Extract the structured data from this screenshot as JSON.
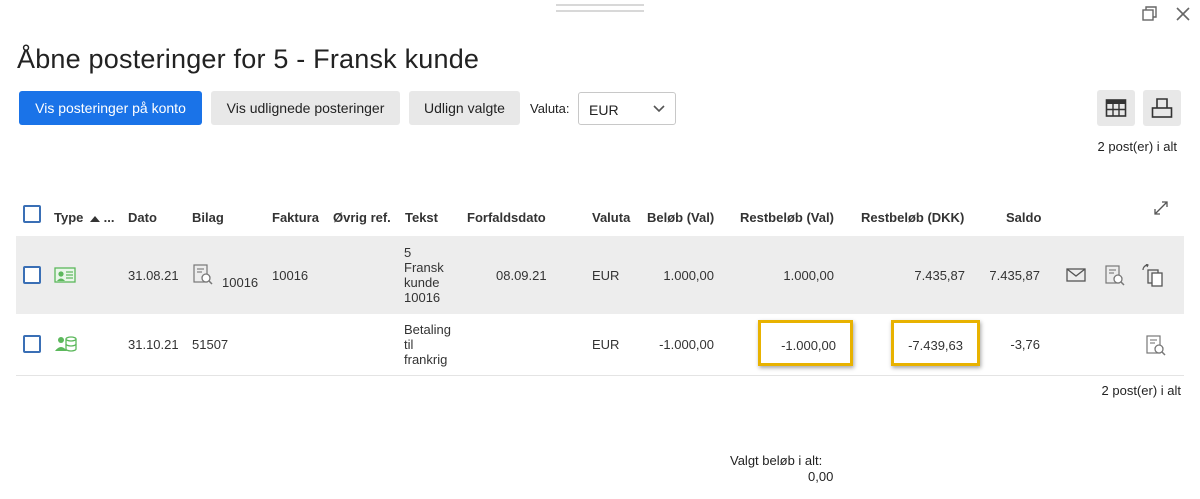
{
  "title": "Åbne posteringer for 5 - Fransk kunde",
  "toolbar": {
    "show_on_account": "Vis posteringer på konto",
    "show_settled": "Vis udlignede posteringer",
    "apply_selected": "Udlign valgte",
    "currency_label": "Valuta:",
    "currency_value": "EUR"
  },
  "count_text": "2 post(er) i alt",
  "columns": {
    "type": "Type",
    "type_more": "...",
    "date": "Dato",
    "voucher": "Bilag",
    "invoice": "Faktura",
    "other_ref": "Øvrig ref.",
    "text": "Tekst",
    "due_date": "Forfaldsdato",
    "currency": "Valuta",
    "amount_val": "Beløb (Val)",
    "remaining_val": "Restbeløb (Val)",
    "remaining_dkk": "Restbeløb (DKK)",
    "balance": "Saldo"
  },
  "rows": [
    {
      "date": "31.08.21",
      "voucher": "10016",
      "invoice": "10016",
      "other_ref": "",
      "text": [
        "5",
        "Fransk",
        "kunde",
        "10016"
      ],
      "due_date": "08.09.21",
      "currency": "EUR",
      "amount_val": "1.000,00",
      "remaining_val": "1.000,00",
      "remaining_dkk": "7.435,87",
      "balance": "7.435,87"
    },
    {
      "date": "31.10.21",
      "voucher": "51507",
      "invoice": "",
      "other_ref": "",
      "text": [
        "Betaling",
        "til",
        "frankrig"
      ],
      "due_date": "",
      "currency": "EUR",
      "amount_val": "-1.000,00",
      "remaining_val": "-1.000,00",
      "remaining_dkk": "-7.439,63",
      "balance": "-3,76"
    }
  ],
  "footer": {
    "selected_label": "Valgt beløb i alt:",
    "selected_value": "0,00"
  },
  "colors": {
    "primary": "#1a73e8",
    "highlight": "#e8b200",
    "type_icon": "#5cb85c",
    "checkbox": "#3a6fb5"
  }
}
